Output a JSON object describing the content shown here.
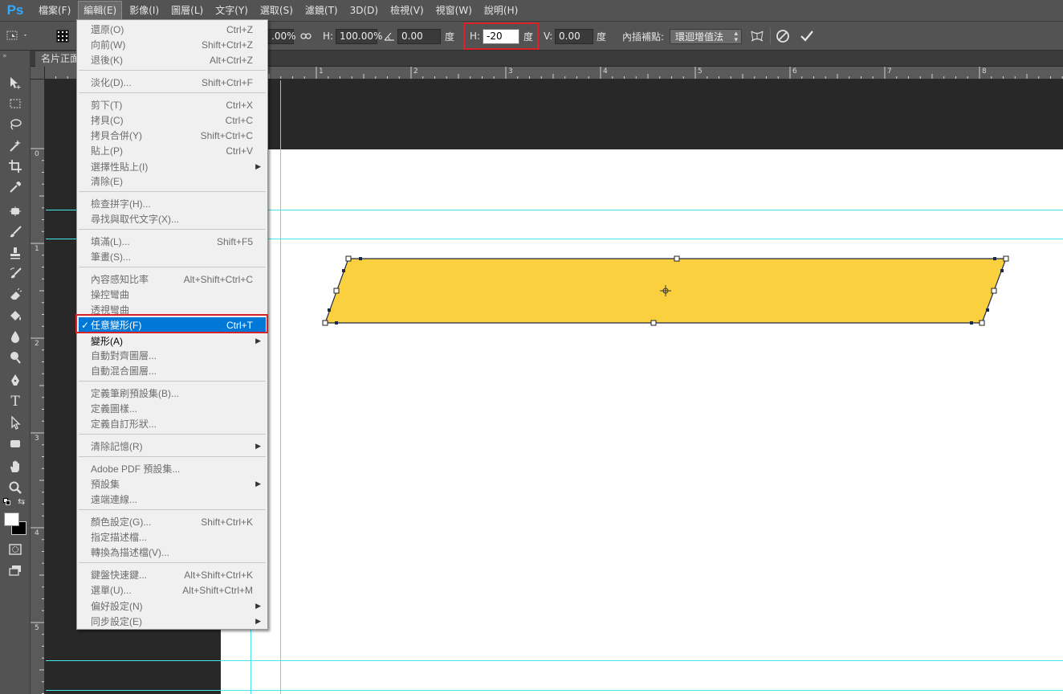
{
  "app": {
    "logo": "Ps"
  },
  "menubar": {
    "items": [
      "檔案(F)",
      "編輯(E)",
      "影像(I)",
      "圖層(L)",
      "文字(Y)",
      "選取(S)",
      "濾鏡(T)",
      "3D(D)",
      "檢視(V)",
      "視窗(W)",
      "說明(H)"
    ],
    "active_index": 1
  },
  "options_bar": {
    "w_value": ".00%",
    "h_label": "H:",
    "h_value": "100.00%",
    "angle_value": "0.00",
    "angle_unit": "度",
    "hskew_label": "H:",
    "hskew_value": "-20",
    "hskew_unit": "度",
    "vskew_label": "V:",
    "vskew_value": "0.00",
    "vskew_unit": "度",
    "interp_label": "內插補點:",
    "interp_value": "環迴增值法",
    "icons": [
      "reference-point-icon",
      "link-icon",
      "angle-icon",
      "warp-icon",
      "cancel-icon",
      "commit-icon"
    ]
  },
  "document": {
    "tab_title": "名片正面"
  },
  "rulers": {
    "top_labels": [
      "1",
      "2",
      "3",
      "4",
      "5",
      "6",
      "7",
      "8"
    ],
    "left_labels": [
      "0",
      "1",
      "2",
      "3",
      "4",
      "5"
    ]
  },
  "shape": {
    "fill": "#fbd03e",
    "stroke": "#1d2a48",
    "skew_degrees": -20
  },
  "tools": [
    "move-icon",
    "marquee-icon",
    "lasso-icon",
    "magic-wand-icon",
    "crop-icon",
    "eyedropper-icon",
    "healing-icon",
    "brush-icon",
    "stamp-icon",
    "history-brush-icon",
    "eraser-icon",
    "paint-bucket-icon",
    "blur-icon",
    "dodge-icon",
    "pen-icon",
    "type-icon",
    "path-select-icon",
    "rectangle-icon",
    "hand-icon",
    "zoom-icon"
  ],
  "edit_menu": {
    "items": [
      {
        "label": "還原(O)",
        "shortcut": "Ctrl+Z",
        "enabled": false
      },
      {
        "label": "向前(W)",
        "shortcut": "Shift+Ctrl+Z",
        "enabled": false
      },
      {
        "label": "退後(K)",
        "shortcut": "Alt+Ctrl+Z",
        "enabled": false
      },
      {
        "label": "淡化(D)...",
        "shortcut": "Shift+Ctrl+F",
        "enabled": false
      },
      {
        "label": "剪下(T)",
        "shortcut": "Ctrl+X",
        "enabled": false
      },
      {
        "label": "拷貝(C)",
        "shortcut": "Ctrl+C",
        "enabled": false
      },
      {
        "label": "拷貝合併(Y)",
        "shortcut": "Shift+Ctrl+C",
        "enabled": false
      },
      {
        "label": "貼上(P)",
        "shortcut": "Ctrl+V",
        "enabled": false
      },
      {
        "label": "選擇性貼上(I)",
        "shortcut": "",
        "enabled": false,
        "submenu": true
      },
      {
        "label": "清除(E)",
        "shortcut": "",
        "enabled": false
      },
      {
        "label": "檢查拼字(H)...",
        "shortcut": "",
        "enabled": false
      },
      {
        "label": "尋找與取代文字(X)...",
        "shortcut": "",
        "enabled": false
      },
      {
        "label": "填滿(L)...",
        "shortcut": "Shift+F5",
        "enabled": false
      },
      {
        "label": "筆畫(S)...",
        "shortcut": "",
        "enabled": false
      },
      {
        "label": "內容感知比率",
        "shortcut": "Alt+Shift+Ctrl+C",
        "enabled": false
      },
      {
        "label": "操控彎曲",
        "shortcut": "",
        "enabled": false
      },
      {
        "label": "透視彎曲",
        "shortcut": "",
        "enabled": false
      },
      {
        "label": "任意變形(F)",
        "shortcut": "Ctrl+T",
        "enabled": true,
        "checked": true,
        "selected": true
      },
      {
        "label": "變形(A)",
        "shortcut": "",
        "enabled": true,
        "submenu": true
      },
      {
        "label": "自動對齊圖層...",
        "shortcut": "",
        "enabled": false
      },
      {
        "label": "自動混合圖層...",
        "shortcut": "",
        "enabled": false
      },
      {
        "label": "定義筆刷預設集(B)...",
        "shortcut": "",
        "enabled": false
      },
      {
        "label": "定義圖樣...",
        "shortcut": "",
        "enabled": false
      },
      {
        "label": "定義自訂形狀...",
        "shortcut": "",
        "enabled": false
      },
      {
        "label": "清除記憶(R)",
        "shortcut": "",
        "enabled": false,
        "submenu": true
      },
      {
        "label": "Adobe PDF 預設集...",
        "shortcut": "",
        "enabled": false
      },
      {
        "label": "預設集",
        "shortcut": "",
        "enabled": false,
        "submenu": true
      },
      {
        "label": "遠端連線...",
        "shortcut": "",
        "enabled": false
      },
      {
        "label": "顏色設定(G)...",
        "shortcut": "Shift+Ctrl+K",
        "enabled": false
      },
      {
        "label": "指定描述檔...",
        "shortcut": "",
        "enabled": false
      },
      {
        "label": "轉換為描述檔(V)...",
        "shortcut": "",
        "enabled": false
      },
      {
        "label": "鍵盤快速鍵...",
        "shortcut": "Alt+Shift+Ctrl+K",
        "enabled": false
      },
      {
        "label": "選單(U)...",
        "shortcut": "Alt+Shift+Ctrl+M",
        "enabled": false
      },
      {
        "label": "偏好設定(N)",
        "shortcut": "",
        "enabled": false,
        "submenu": true
      },
      {
        "label": "同步設定(E)",
        "shortcut": "",
        "enabled": false,
        "submenu": true
      }
    ]
  }
}
